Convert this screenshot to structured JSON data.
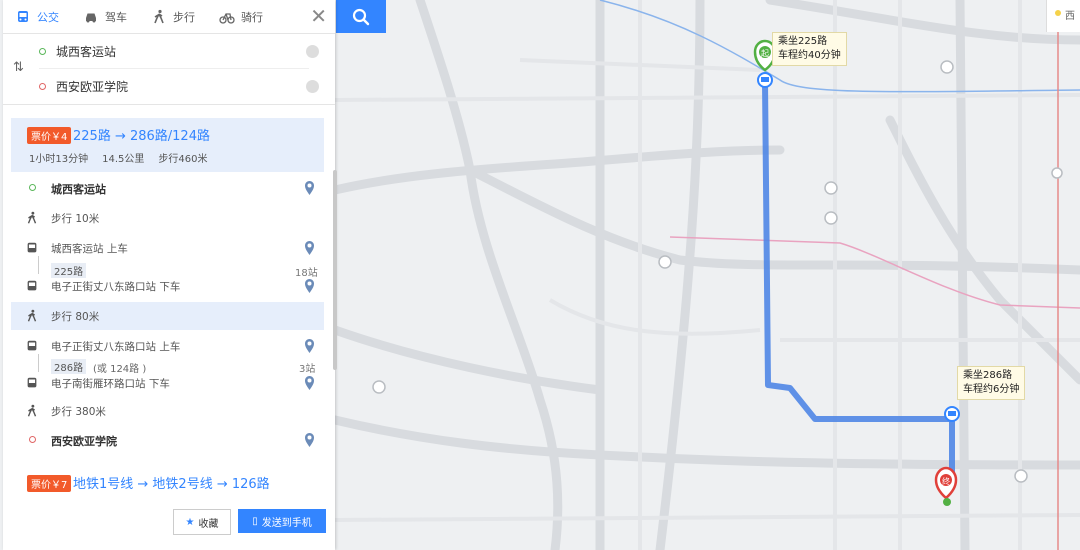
{
  "modes": [
    {
      "label": "公交",
      "icon": "bus-icon",
      "active": true
    },
    {
      "label": "驾车",
      "icon": "car-icon",
      "active": false
    },
    {
      "label": "步行",
      "icon": "walk-icon",
      "active": false
    },
    {
      "label": "骑行",
      "icon": "bike-icon",
      "active": false
    }
  ],
  "origin": "城西客运站",
  "destination": "西安欧亚学院",
  "route1": {
    "fare": "票价￥4",
    "title": "225路 → 286路/124路",
    "duration": "1小时13分钟",
    "distance": "14.5公里",
    "walk": "步行460米"
  },
  "steps": {
    "start": "城西客运站",
    "walk1": "步行  10米",
    "board1": "城西客运站   上车",
    "line1": "225路",
    "line1_stops": "18站",
    "alight1": "电子正街丈八东路口站   下车",
    "walk2": "步行  80米",
    "board2": "电子正街丈八东路口站   上车",
    "line2": "286路",
    "line2_alt": "(或 124路 )",
    "line2_stops": "3站",
    "alight2": "电子南街雁环路口站   下车",
    "walk3": "步行  380米",
    "end": "西安欧亚学院"
  },
  "route2": {
    "fare": "票价￥7",
    "title": "地铁1号线 → 地铁2号线 → 126路"
  },
  "footer": {
    "favorite": "收藏",
    "send": "发送到手机"
  },
  "map": {
    "callout1_line1": "乘坐225路",
    "callout1_line2": "车程约40分钟",
    "callout2_line1": "乘坐286路",
    "callout2_line2": "车程约6分钟",
    "start_marker": "起",
    "end_marker": "终",
    "corner_label": "西",
    "route_color": "#4f86e6"
  }
}
